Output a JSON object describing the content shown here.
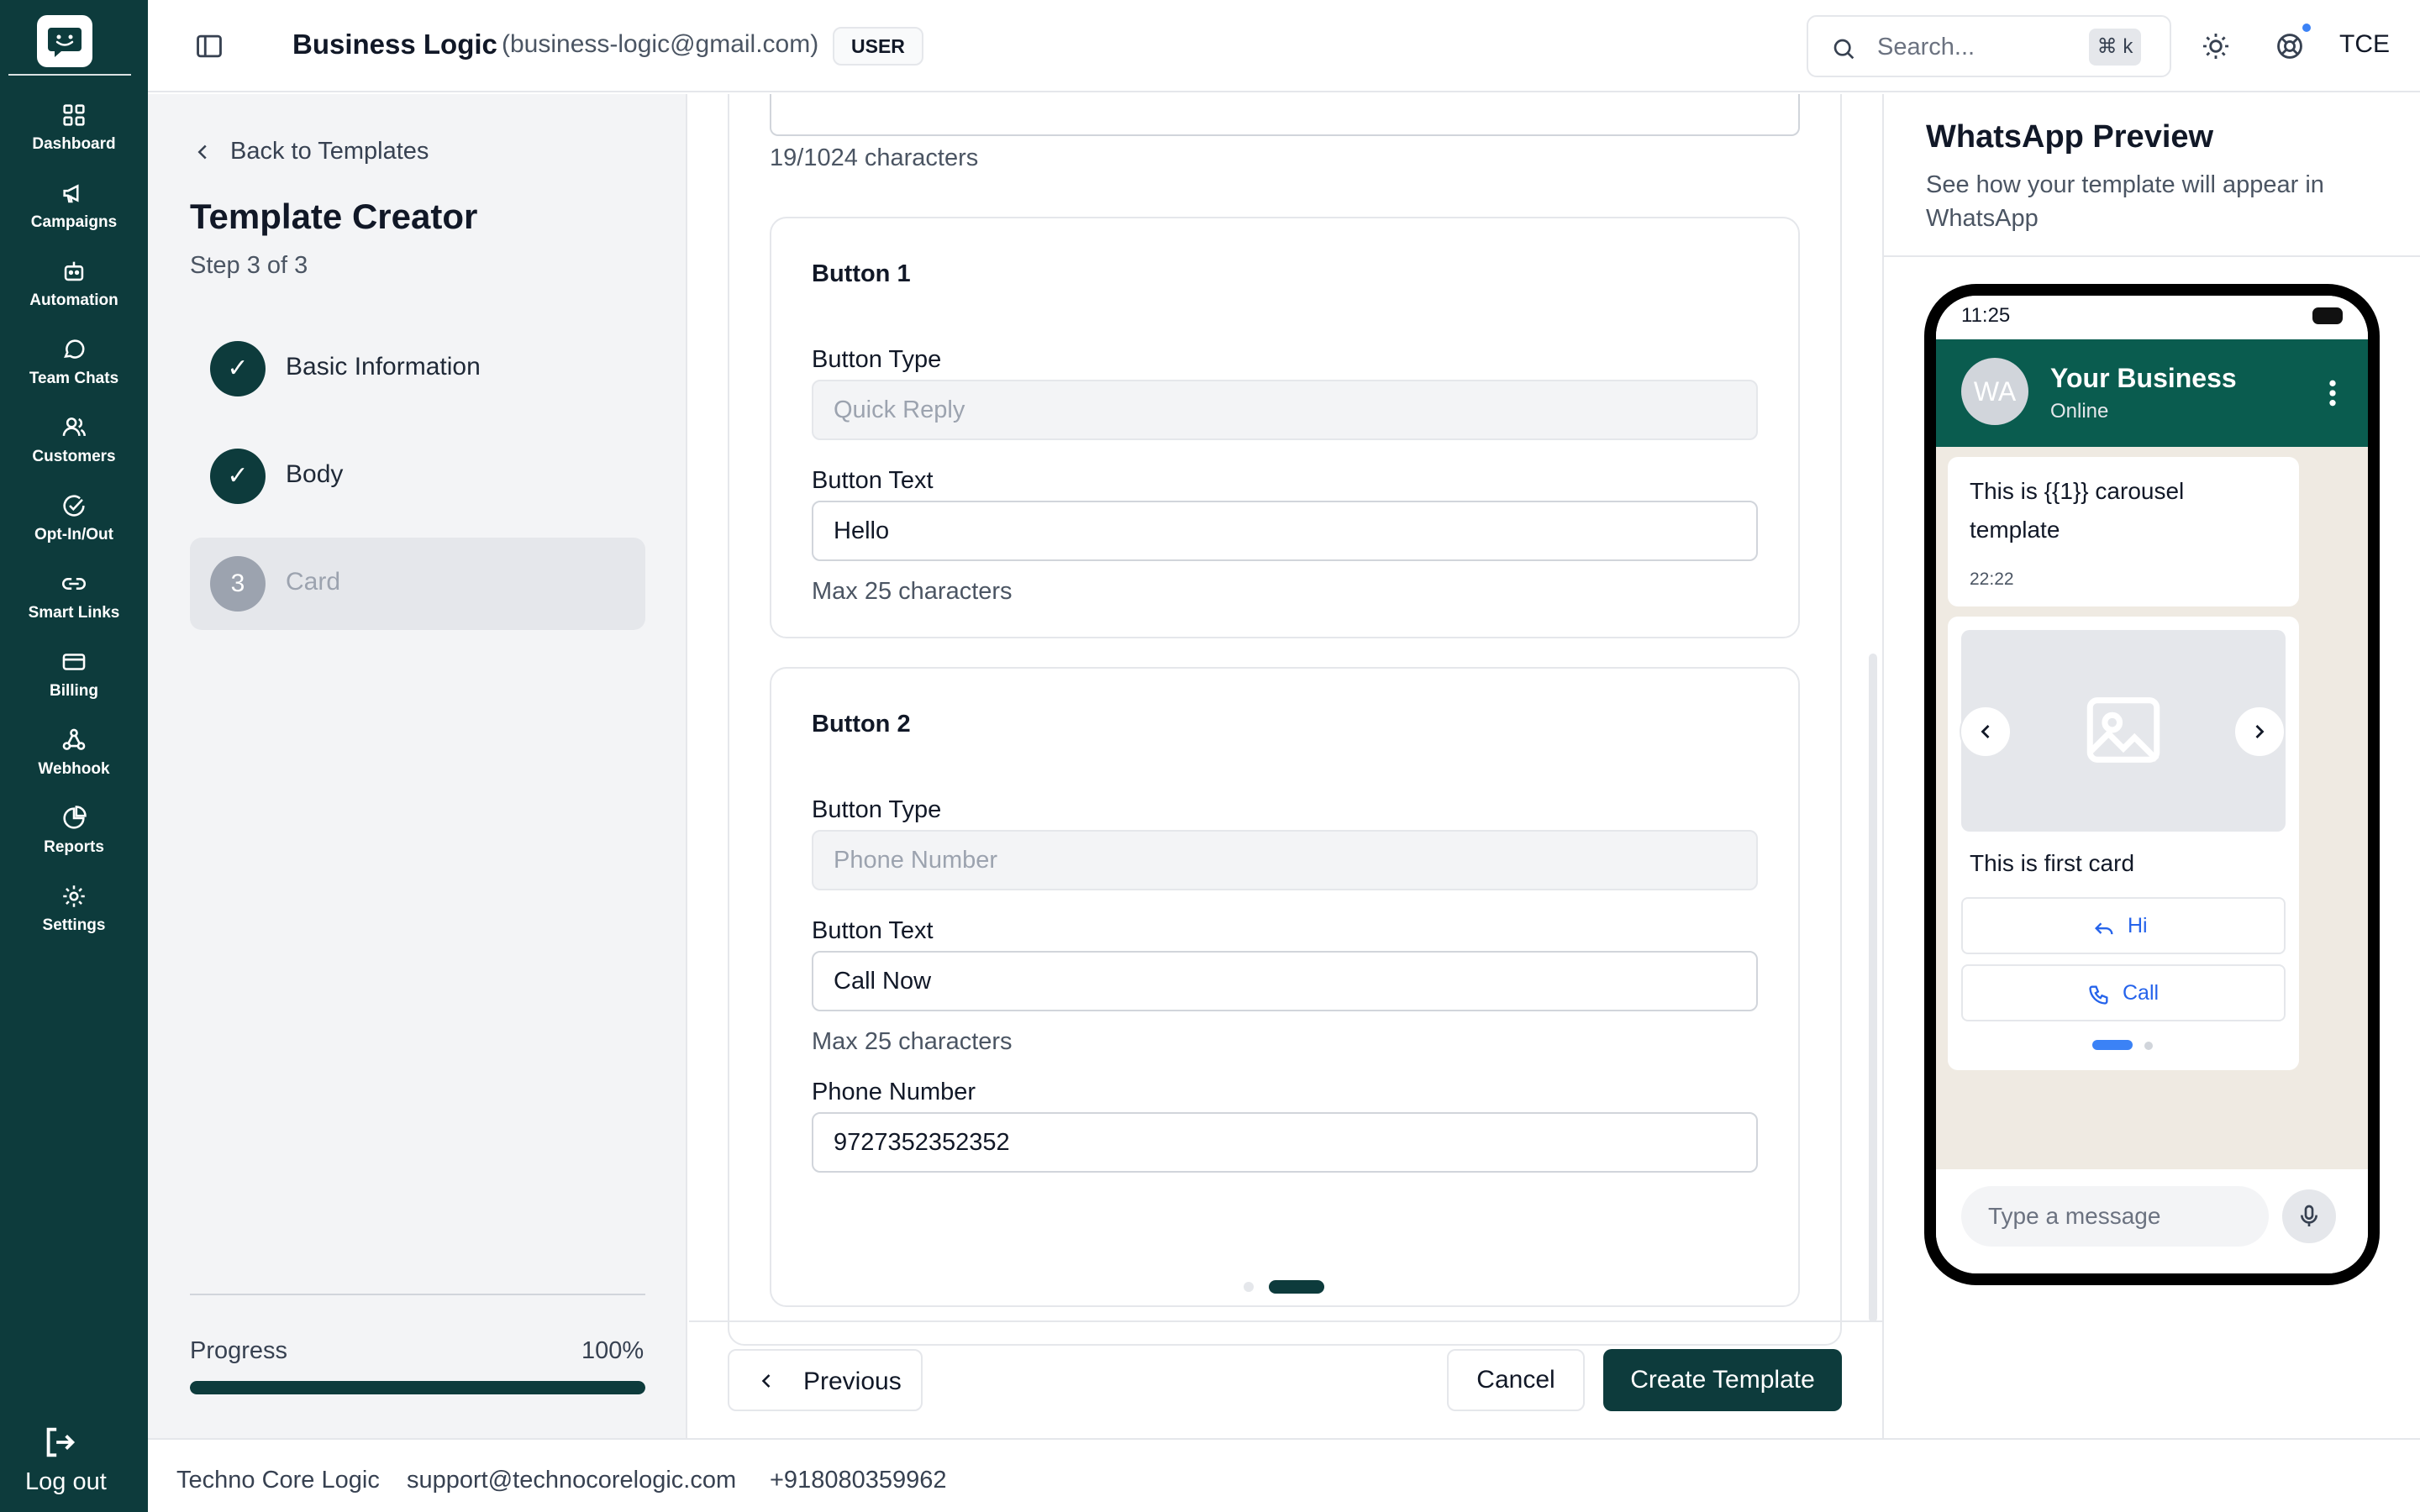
{
  "app": {
    "brand_color": "#0d3b3c",
    "accent_color": "#3b82f6"
  },
  "nav": {
    "items": [
      {
        "label": "Dashboard",
        "icon": "dashboard-icon"
      },
      {
        "label": "Campaigns",
        "icon": "megaphone-icon"
      },
      {
        "label": "Automation",
        "icon": "bot-icon"
      },
      {
        "label": "Team Chats",
        "icon": "chat-bubble-icon"
      },
      {
        "label": "Customers",
        "icon": "users-icon"
      },
      {
        "label": "Opt-In/Out",
        "icon": "check-circle-icon"
      },
      {
        "label": "Smart Links",
        "icon": "link-icon"
      },
      {
        "label": "Billing",
        "icon": "credit-card-icon"
      },
      {
        "label": "Webhook",
        "icon": "webhook-icon"
      },
      {
        "label": "Reports",
        "icon": "pie-chart-icon"
      },
      {
        "label": "Settings",
        "icon": "gear-icon"
      }
    ],
    "logout_label": "Log out"
  },
  "header": {
    "business_name": "Business Logic",
    "business_email": "(business-logic@gmail.com)",
    "role_badge": "USER",
    "search_placeholder": "Search...",
    "search_shortcut": "⌘ k",
    "user_initials": "TCE"
  },
  "steps_panel": {
    "back_label": "Back to Templates",
    "title": "Template Creator",
    "step_indicator": "Step 3 of 3",
    "steps": [
      {
        "number": "✓",
        "label": "Basic Information",
        "status": "complete"
      },
      {
        "number": "✓",
        "label": "Body",
        "status": "complete"
      },
      {
        "number": "3",
        "label": "Card",
        "status": "current"
      }
    ],
    "progress_label": "Progress",
    "progress_value": "100%",
    "progress_fraction": 1.0
  },
  "form": {
    "body_char_count": "19/1024 characters",
    "buttons": [
      {
        "title": "Button 1",
        "type_label": "Button Type",
        "type_value": "Quick Reply",
        "text_label": "Button Text",
        "text_value": "Hello",
        "text_hint": "Max 25 characters"
      },
      {
        "title": "Button 2",
        "type_label": "Button Type",
        "type_value": "Phone Number",
        "text_label": "Button Text",
        "text_value": "Call Now",
        "text_hint": "Max 25 characters",
        "phone_label": "Phone Number",
        "phone_value": "9727352352352"
      }
    ],
    "previous_label": "Previous",
    "cancel_label": "Cancel",
    "create_label": "Create Template"
  },
  "preview": {
    "title": "WhatsApp Preview",
    "subtitle": "See how your template will appear in WhatsApp",
    "phone_time": "11:25",
    "avatar_initials": "WA",
    "contact_name": "Your Business",
    "contact_status": "Online",
    "message_text": "This is {{1}} carousel template",
    "message_time": "22:22",
    "card_text": "This is first card",
    "card_actions": [
      {
        "label": "Hi",
        "icon": "reply-icon"
      },
      {
        "label": "Call",
        "icon": "phone-icon"
      }
    ],
    "input_placeholder": "Type a message"
  },
  "footer": {
    "company": "Techno Core Logic",
    "email": "support@technocorelogic.com",
    "phone": "+918080359962"
  }
}
